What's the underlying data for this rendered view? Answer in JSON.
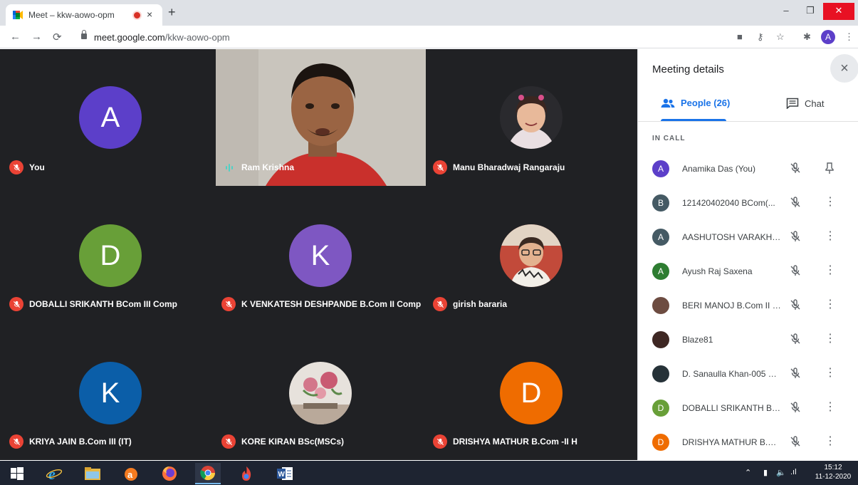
{
  "browser": {
    "tab_title": "Meet – kkw-aowo-opm",
    "tab_close": "×",
    "new_tab": "+",
    "url_host": "meet.google.com",
    "url_path": "/kkw-aowo-opm",
    "profile_initial": "A",
    "window_buttons": {
      "minimize": "–",
      "maximize": "❐",
      "close": "✕"
    }
  },
  "tiles": [
    {
      "name": "You",
      "type": "initial",
      "initial": "A",
      "color": "#5c3fc9",
      "muted": true
    },
    {
      "name": "Ram Krishna",
      "type": "video",
      "muted": false,
      "speaking": true
    },
    {
      "name": "Manu Bharadwaj Rangaraju",
      "type": "photo",
      "muted": true
    },
    {
      "name": "DOBALLI SRIKANTH BCom III Comp",
      "type": "initial",
      "initial": "D",
      "color": "#689f38",
      "muted": true
    },
    {
      "name": "K VENKATESH DESHPANDE B.Com II Comp",
      "type": "initial",
      "initial": "K",
      "color": "#7e57c2",
      "muted": true
    },
    {
      "name": "girish bararia",
      "type": "photo",
      "muted": true
    },
    {
      "name": "KRIYA JAIN B.Com III (IT)",
      "type": "initial",
      "initial": "K",
      "color": "#0b5ea8",
      "muted": true
    },
    {
      "name": "KORE KIRAN BSc(MSCs)",
      "type": "photo",
      "muted": true
    },
    {
      "name": "DRISHYA MATHUR B.Com -II H",
      "type": "initial",
      "initial": "D",
      "color": "#ef6c00",
      "muted": true
    }
  ],
  "panel": {
    "title": "Meeting details",
    "close": "×",
    "tab_people": "People (26)",
    "tab_chat": "Chat",
    "section": "IN CALL",
    "people": [
      {
        "name": "Anamika Das (You)",
        "initial": "A",
        "color": "#5c3fc9",
        "action": "pin"
      },
      {
        "name": "121420402040 BCom(...",
        "initial": "B",
        "color": "#455a64",
        "action": "more"
      },
      {
        "name": "AASHUTOSH VARAKHE...",
        "initial": "A",
        "color": "#455a64",
        "action": "more"
      },
      {
        "name": "Ayush Raj Saxena",
        "initial": "A",
        "color": "#2e7d32",
        "action": "more"
      },
      {
        "name": "BERI MANOJ B.Com II IFA",
        "initial": "",
        "color": "#6d4c41",
        "action": "more"
      },
      {
        "name": "Blaze81",
        "initial": "",
        "color": "#3e2723",
        "action": "more"
      },
      {
        "name": "D. Sanaulla Khan-005 B....",
        "initial": "",
        "color": "#263238",
        "action": "more"
      },
      {
        "name": "DOBALLI SRIKANTH BC...",
        "initial": "D",
        "color": "#689f38",
        "action": "more"
      },
      {
        "name": "DRISHYA MATHUR B.Co...",
        "initial": "D",
        "color": "#ef6c00",
        "action": "more"
      }
    ]
  },
  "taskbar": {
    "time": "15:12",
    "date": "11-12-2020"
  }
}
